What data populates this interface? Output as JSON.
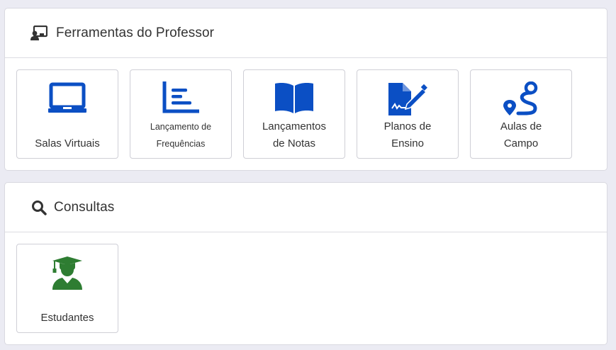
{
  "colors": {
    "icon_blue": "#0b4fc4",
    "icon_green": "#2e7d32",
    "header_icon": "#333333"
  },
  "professor_section": {
    "title": "Ferramentas do Professor",
    "icon": "chalkboard-teacher-icon",
    "tiles": [
      {
        "label_1": "Salas Virtuais",
        "icon": "laptop-icon"
      },
      {
        "label_1": "Lançamento de",
        "label_2": "Frequências",
        "icon": "bar-list-icon"
      },
      {
        "label_1": "Lançamentos",
        "label_2": "de Notas",
        "icon": "open-book-icon"
      },
      {
        "label_1": "Planos de",
        "label_2": "Ensino",
        "icon": "file-signature-icon"
      },
      {
        "label_1": "Aulas de",
        "label_2": "Campo",
        "icon": "route-icon"
      }
    ]
  },
  "consultas_section": {
    "title": "Consultas",
    "icon": "search-icon",
    "tiles": [
      {
        "label_1": "Estudantes",
        "icon": "graduate-icon"
      }
    ]
  }
}
